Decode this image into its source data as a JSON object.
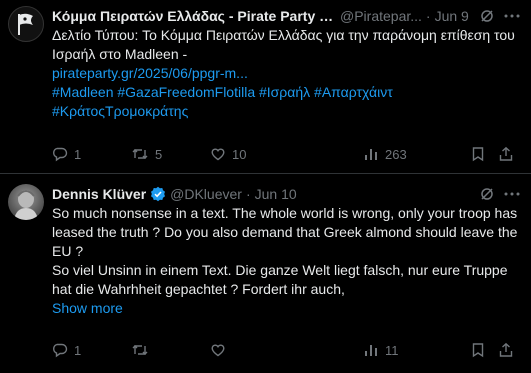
{
  "colors": {
    "background": "#000000",
    "text": "#e7e9ea",
    "muted": "#71767b",
    "link": "#1d9bf0",
    "verified": "#1d9bf0",
    "divider": "#2f3336"
  },
  "tweets": [
    {
      "display_name": "Κόμμα Πειρατών Ελλάδας - Pirate Party of ...",
      "handle": "@Piratepar...",
      "dot": "·",
      "date": "Jun 9",
      "avatar_icon": "pirate-flag-icon",
      "text_line_1": "Δελτίο Τύπου: Το Κόμμα Πειρατών Ελλάδας για την παράνομη επίθεση του",
      "text_line_2": "Ισραήλ στο Madleen -",
      "link": "pirateparty.gr/2025/06/ppgr-m...",
      "hashtags_line_1": "#Madleen #GazaFreedomFlotilla #Ισραήλ #Απαρτχάιντ",
      "hashtags_line_2": "#ΚράτοςΤρομοκράτης",
      "stats": {
        "replies": "1",
        "reposts": "5",
        "likes": "10",
        "views": "263"
      }
    },
    {
      "display_name": "Dennis Klüver",
      "handle": "@DKluever",
      "dot": "·",
      "date": "Jun 10",
      "verified": true,
      "avatar_icon": "user-photo-avatar",
      "text_line_1": "So much nonsense in a text.  The whole world is wrong, only your troop has",
      "text_line_2": "leased the truth ? Do you also demand that Greek almond should leave the",
      "text_line_3": "EU ?",
      "text_line_4": "So viel Unsinn in einem Text.  Die ganze Welt liegt falsch, nur eure Truppe",
      "text_line_5": "hat die Wahrhheit gepachtet ? Fordert ihr auch,",
      "show_more": "Show more",
      "stats": {
        "replies": "1",
        "reposts": "",
        "likes": "",
        "views": "11"
      }
    }
  ]
}
